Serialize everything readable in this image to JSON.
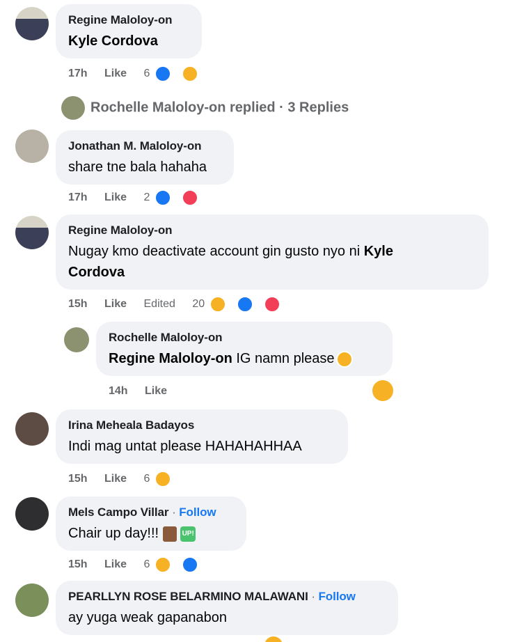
{
  "comments": [
    {
      "name": "Regine Maloloy-on",
      "text_mention": "Kyle Cordova",
      "time": "17h",
      "like": "Like",
      "count": "6"
    },
    {
      "name": "Jonathan M. Maloloy-on",
      "text": "share tne bala hahaha",
      "time": "17h",
      "like": "Like",
      "count": "2"
    },
    {
      "name": "Regine Maloloy-on",
      "text": "Nugay kmo deactivate account gin gusto nyo ni ",
      "text_mention": "Kyle",
      "text_line2_mention": "Cordova",
      "time": "15h",
      "like": "Like",
      "edited": "Edited",
      "count": "20"
    },
    {
      "name": "Irina Meheala Badayos",
      "text": "Indi mag untat please HAHAHAHHAA",
      "time": "15h",
      "like": "Like",
      "count": "6"
    },
    {
      "name": "Mels Campo Villar",
      "follow": "Follow",
      "text": "Chair up day!!! ",
      "time": "15h",
      "like": "Like",
      "count": "6"
    },
    {
      "name": "PEARLLYN ROSE BELARMINO MALAWANI",
      "follow": "Follow",
      "text": "ay yuga weak gapanabon"
    }
  ],
  "replied_summary": "Rochelle Maloloy-on replied · 3 Replies",
  "reply": {
    "name": "Rochelle Maloloy-on",
    "mention": "Regine Maloloy-on",
    "text": " IG namn please",
    "time": "14h",
    "like": "Like"
  },
  "separator": "·",
  "up_badge": "UP!"
}
